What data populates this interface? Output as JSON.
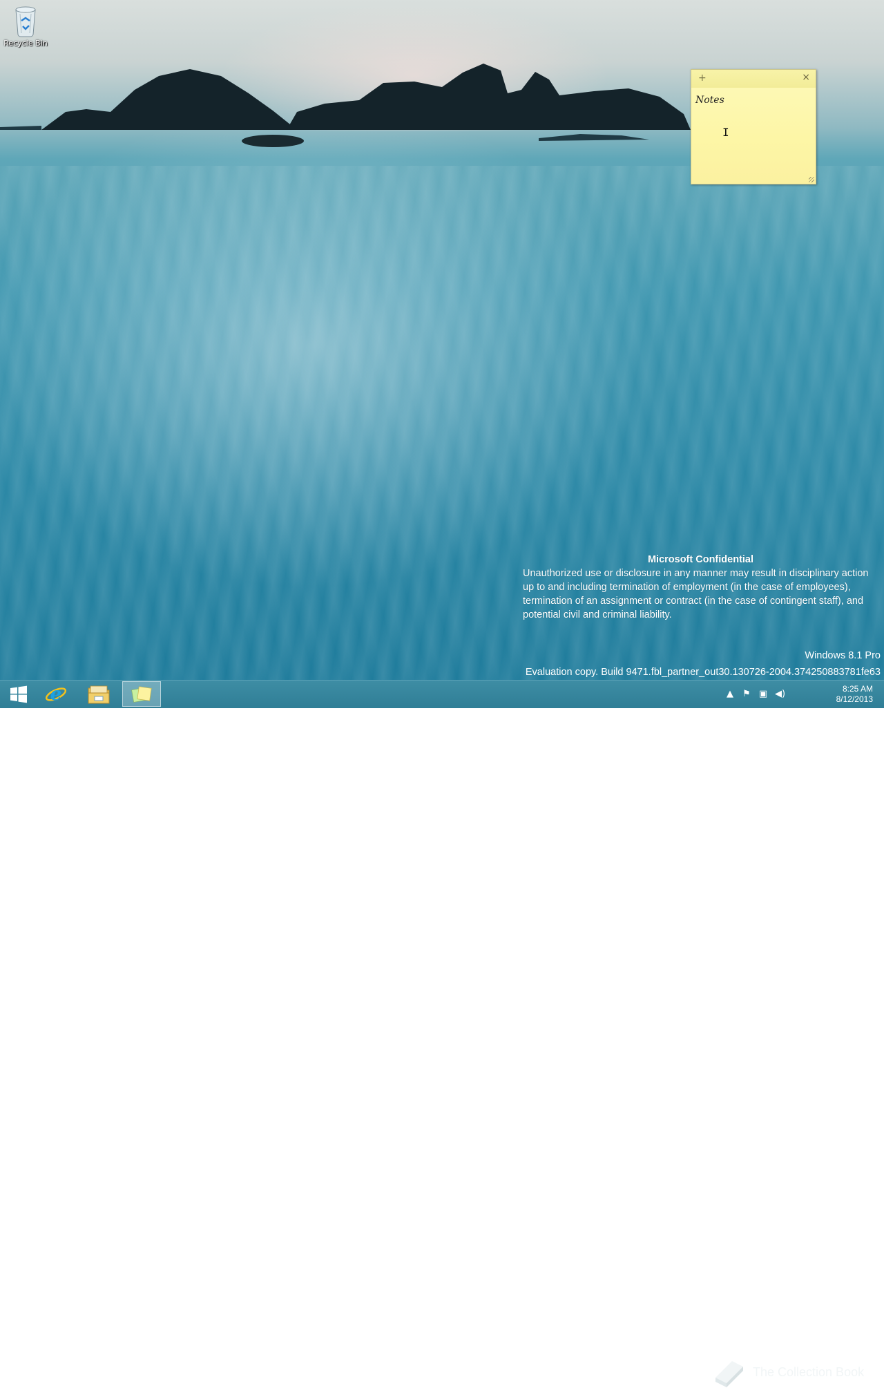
{
  "desktop": {
    "recycle_bin_label": "Recycle Bin"
  },
  "sticky_note": {
    "add_symbol": "+",
    "close_symbol": "×",
    "text": "Notes",
    "text_cursor": "I"
  },
  "confidential": {
    "title": "Microsoft Confidential",
    "body": "Unauthorized use or disclosure in any manner may result in disciplinary action up to and including termination of employment (in the case of employees), termination of an assignment or contract (in the case of contingent staff), and potential civil and criminal liability."
  },
  "edition": "Windows 8.1 Pro",
  "build": "Evaluation copy. Build 9471.fbl_partner_out30.130726-2004.374250883781fe63",
  "taskbar": {
    "pinned": [
      {
        "name": "start",
        "icon": "windows-logo-icon"
      },
      {
        "name": "internet-explorer",
        "icon": "internet-explorer-icon"
      },
      {
        "name": "file-explorer",
        "icon": "folder-icon"
      },
      {
        "name": "sticky-notes",
        "icon": "sticky-notes-icon",
        "active": true
      }
    ],
    "tray_icons": [
      "chevron-up-icon",
      "flag-icon",
      "network-icon",
      "volume-icon"
    ],
    "clock_time": "8:25 AM",
    "clock_date": "8/12/2013"
  },
  "watermark": {
    "brand_text": "The Collection Book"
  },
  "colors": {
    "taskbar": "#2f7e96",
    "sticky_note": "#fdf6a6",
    "windows_logo": "#ffffff",
    "ie_blue": "#1ba1e2",
    "ie_ring": "#f4c21c"
  }
}
